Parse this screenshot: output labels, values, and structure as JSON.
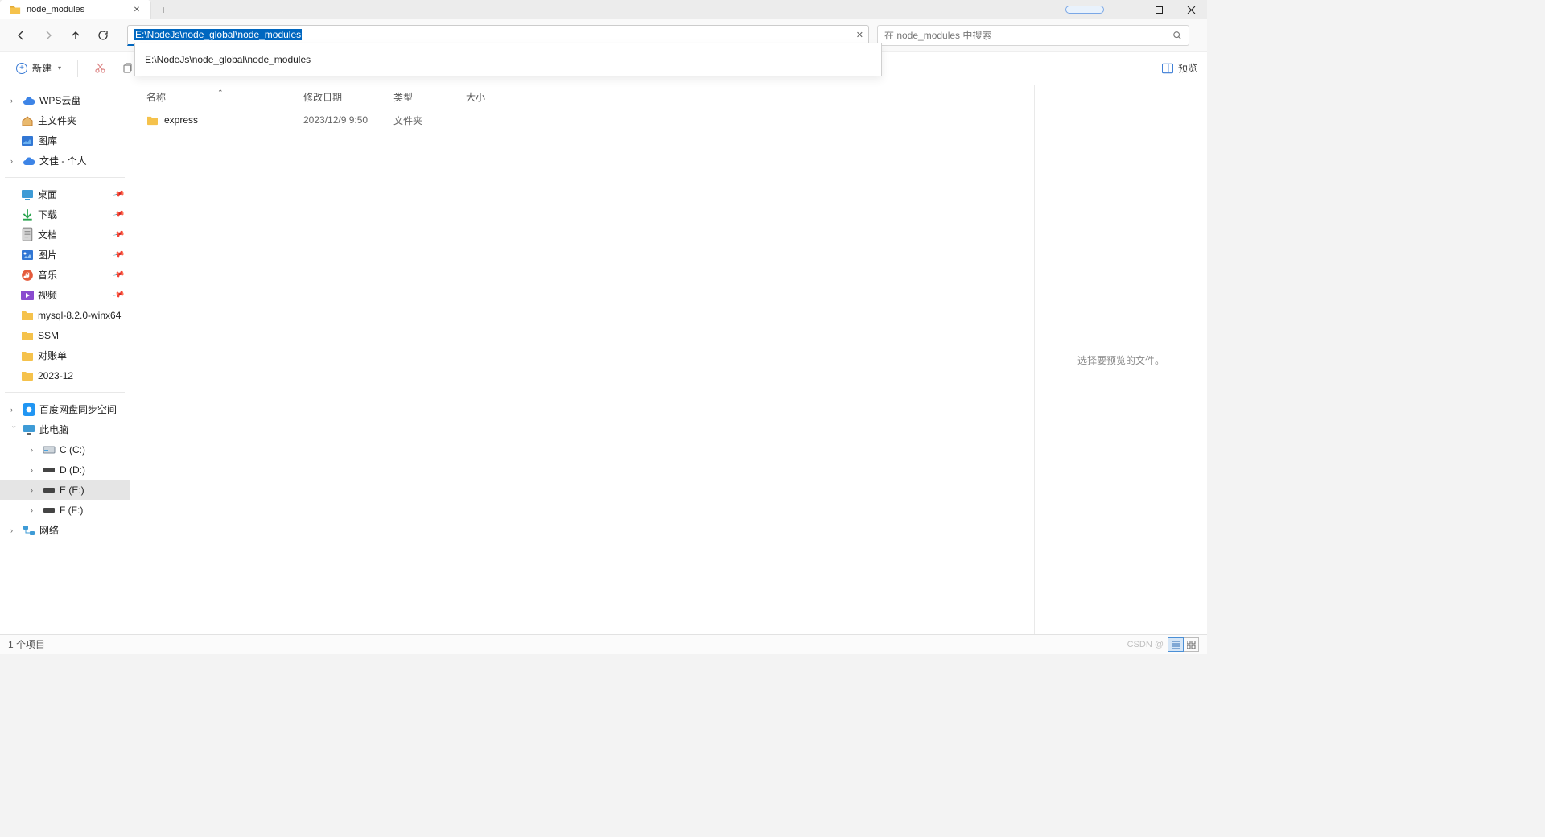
{
  "tab": {
    "title": "node_modules"
  },
  "address": {
    "path": "E:\\NodeJs\\node_global\\node_modules",
    "suggestion": "E:\\NodeJs\\node_global\\node_modules"
  },
  "search": {
    "placeholder": "在 node_modules 中搜索"
  },
  "toolbar": {
    "new_label": "新建",
    "preview_label": "预览"
  },
  "columns": {
    "name": "名称",
    "date": "修改日期",
    "type": "类型",
    "size": "大小"
  },
  "rows": [
    {
      "name": "express",
      "date": "2023/12/9 9:50",
      "type": "文件夹",
      "size": ""
    }
  ],
  "sidebar": {
    "group1": [
      {
        "label": "WPS云盘",
        "icon": "cloud-blue",
        "expander": true
      },
      {
        "label": "主文件夹",
        "icon": "home",
        "expander": false
      },
      {
        "label": "图库",
        "icon": "gallery",
        "expander": false
      },
      {
        "label": "文佳 - 个人",
        "icon": "cloud-blue",
        "expander": true
      }
    ],
    "group2": [
      {
        "label": "桌面",
        "icon": "desktop",
        "pin": true
      },
      {
        "label": "下载",
        "icon": "download",
        "pin": true
      },
      {
        "label": "文档",
        "icon": "docs",
        "pin": true
      },
      {
        "label": "图片",
        "icon": "pictures",
        "pin": true
      },
      {
        "label": "音乐",
        "icon": "music",
        "pin": true
      },
      {
        "label": "视频",
        "icon": "video",
        "pin": true
      },
      {
        "label": "mysql-8.2.0-winx64",
        "icon": "folder"
      },
      {
        "label": "SSM",
        "icon": "folder"
      },
      {
        "label": "对账单",
        "icon": "folder"
      },
      {
        "label": "2023-12",
        "icon": "folder"
      }
    ],
    "group3": [
      {
        "label": "百度网盘同步空间",
        "icon": "baidu",
        "expander": true
      },
      {
        "label": "此电脑",
        "icon": "pc",
        "expander": true,
        "expanded": true
      },
      {
        "label": "C (C:)",
        "icon": "drive",
        "expander": true,
        "indent": 3
      },
      {
        "label": "D (D:)",
        "icon": "drive-dark",
        "expander": true,
        "indent": 3
      },
      {
        "label": "E (E:)",
        "icon": "drive-dark",
        "expander": true,
        "indent": 3,
        "selected": true
      },
      {
        "label": "F (F:)",
        "icon": "drive-dark",
        "expander": true,
        "indent": 3
      },
      {
        "label": "网络",
        "icon": "network",
        "expander": true
      }
    ]
  },
  "preview": {
    "empty_text": "选择要预览的文件。"
  },
  "status": {
    "count_text": "1 个项目",
    "watermark": "CSDN @"
  }
}
